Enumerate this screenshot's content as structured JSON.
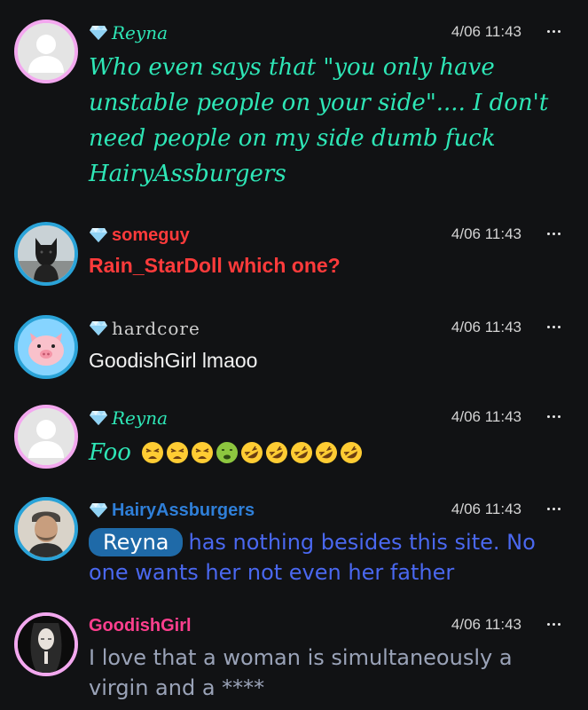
{
  "messages": [
    {
      "username": "Reyna",
      "timestamp": "4/06 11:43",
      "text": "Who even says that \"you only have unstable people on your side\".... I don't need people on my side dumb fuck HairyAssburgers",
      "username_color": "#2ee6b6",
      "text_color": "#2ee6b6",
      "avatar": "default-user-avatar"
    },
    {
      "username": "someguy",
      "timestamp": "4/06 11:43",
      "text": "Rain_StarDoll which one?",
      "username_color": "#ff3b3b",
      "text_color": "#ff3b3b",
      "avatar": "dog-photo-avatar"
    },
    {
      "username": "hardcore",
      "timestamp": "4/06 11:43",
      "text": "GoodishGirl lmaoo",
      "username_color": "#cfcfcf",
      "text_color": "#f2f2f2",
      "avatar": "pig-avatar"
    },
    {
      "username": "Reyna",
      "timestamp": "4/06 11:43",
      "text": "Foo",
      "emojis": [
        "tired-face",
        "tired-face",
        "tired-face",
        "nauseated-face",
        "rofl",
        "rofl",
        "rofl",
        "rofl",
        "rofl"
      ],
      "username_color": "#2ee6b6",
      "text_color": "#2ee6b6",
      "avatar": "default-user-avatar"
    },
    {
      "username": "HairyAssburgers",
      "timestamp": "4/06 11:43",
      "mention": "Reyna",
      "text": "has nothing besides this site. No one wants her not even her father",
      "username_color": "#2f7fd8",
      "text_color": "#4a68f0",
      "avatar": "man-photo-avatar"
    },
    {
      "username": "GoodishGirl",
      "timestamp": "4/06 11:43",
      "text": "I love that a woman is simultaneously a virgin and a ****",
      "username_color": "#ff3f8e",
      "text_color": "#9aa3b8",
      "avatar": "woman-photo-avatar"
    }
  ],
  "icons": {
    "badge": "diamond-gem-icon",
    "menu": "more-options-icon"
  }
}
